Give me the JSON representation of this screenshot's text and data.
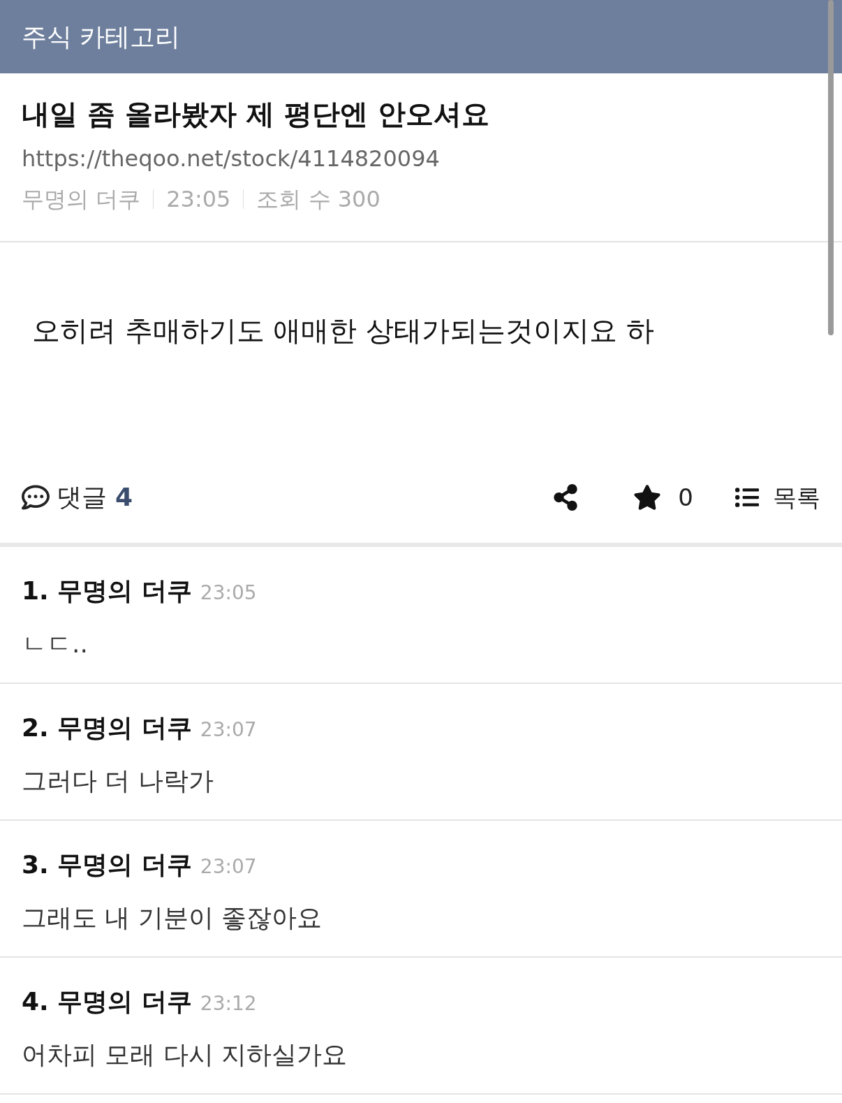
{
  "header": {
    "title": "주식 카테고리"
  },
  "post": {
    "title": "내일 좀 올라봤자 제 평단엔 안오셔요",
    "url": "https://theqoo.net/stock/4114820094",
    "meta": [
      "무명의 더쿠",
      "23:05",
      "조회 수 300"
    ],
    "body": "오히려 추매하기도 애매한 상태가되는것이지요 하"
  },
  "actions": {
    "comments_label": "댓글",
    "comments_count": "4",
    "star_count": "0",
    "list_label": "목록"
  },
  "comments": [
    {
      "number": "1.",
      "author": "무명의 더쿠",
      "time": "23:05",
      "text": "ㄴㄷ.."
    },
    {
      "number": "2.",
      "author": "무명의 더쿠",
      "time": "23:07",
      "text": "그러다 더 나락가"
    },
    {
      "number": "3.",
      "author": "무명의 더쿠",
      "time": "23:07",
      "text": "그래도 내 기분이 좋잖아요"
    },
    {
      "number": "4.",
      "author": "무명의 더쿠",
      "time": "23:12",
      "text": "어차피 모래 다시 지하실가요"
    }
  ]
}
